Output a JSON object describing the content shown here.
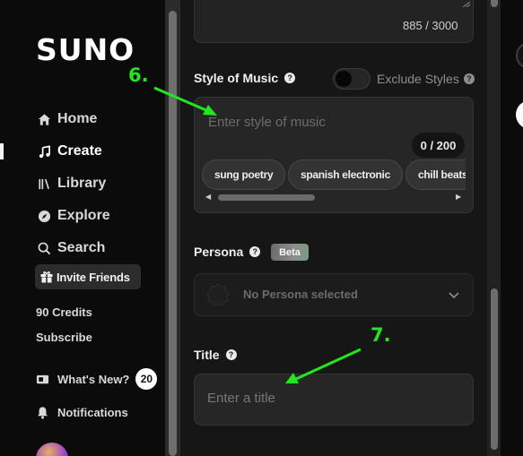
{
  "sidebar": {
    "logo": "SUNO",
    "nav": [
      {
        "label": "Home",
        "icon": "home-icon"
      },
      {
        "label": "Create",
        "icon": "music-note-icon"
      },
      {
        "label": "Library",
        "icon": "library-icon"
      },
      {
        "label": "Explore",
        "icon": "compass-icon"
      },
      {
        "label": "Search",
        "icon": "search-icon"
      }
    ],
    "active_item": "Create",
    "invite_label": "Invite Friends",
    "credits": "90 Credits",
    "subscribe": "Subscribe",
    "whats_new": {
      "label": "What's New?",
      "count": "20"
    },
    "notifications": "Notifications"
  },
  "lyrics": {
    "count": "885 / 3000"
  },
  "style": {
    "label": "Style of Music",
    "exclude_label": "Exclude Styles",
    "exclude_enabled": false,
    "placeholder": "Enter style of music",
    "count": "0 / 200",
    "suggestions": [
      "sung poetry",
      "spanish electronic",
      "chill beats"
    ]
  },
  "persona": {
    "label": "Persona",
    "badge": "Beta",
    "selected": "No Persona selected"
  },
  "title": {
    "label": "Title",
    "placeholder": "Enter a title"
  },
  "annotations": {
    "step6": "6.",
    "step7": "7.",
    "color": "#22e61f"
  },
  "colors": {
    "background": "#0b0b0b",
    "panel": "#161616",
    "accent_annotation": "#22e61f"
  }
}
